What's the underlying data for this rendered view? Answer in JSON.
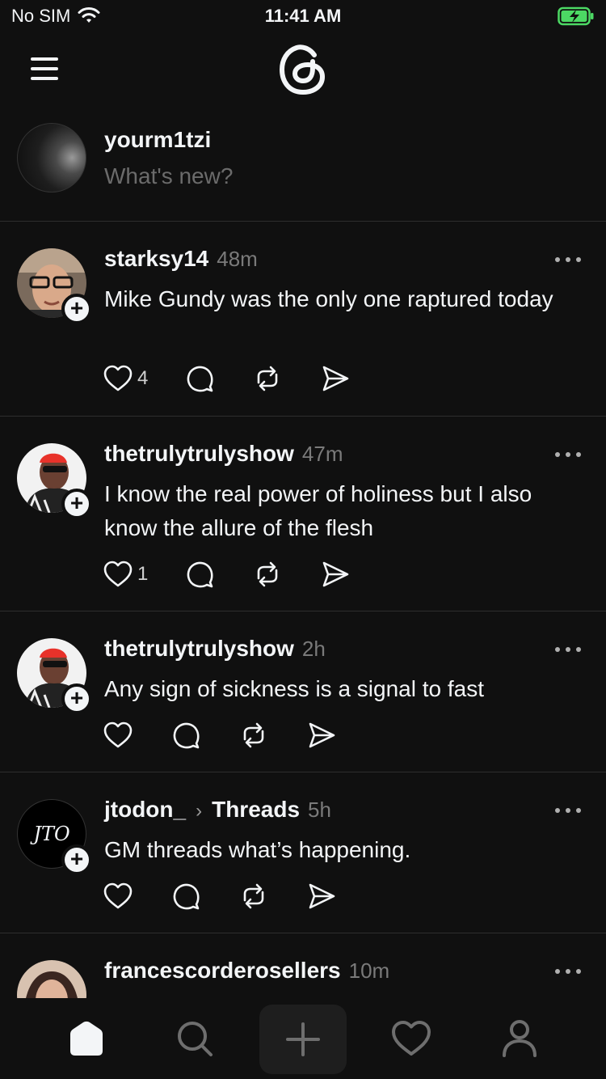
{
  "status": {
    "carrier": "No SIM",
    "time": "11:41 AM"
  },
  "composer": {
    "username": "yourm1tzi",
    "placeholder": "What's new?"
  },
  "posts": [
    {
      "username": "starksy14",
      "time": "48m",
      "text": "Mike Gundy was the only one raptured today",
      "likes": "4"
    },
    {
      "username": "thetrulytrulyshow",
      "time": "47m",
      "text": "I know the real power of holiness but I also know the allure of the flesh",
      "likes": "1"
    },
    {
      "username": "thetrulytrulyshow",
      "time": "2h",
      "text": "Any sign of sickness is a signal to fast",
      "likes": ""
    },
    {
      "username": "jtodon_",
      "community": "Threads",
      "time": "5h",
      "text": "GM threads what’s happening.",
      "likes": "",
      "avatar_text": "JTO"
    },
    {
      "username": "francescorderosellers",
      "time": "10m",
      "text": "",
      "likes": ""
    }
  ],
  "icons": {
    "menu": "menu-icon",
    "logo": "threads-logo-icon",
    "like": "heart-icon",
    "reply": "comment-icon",
    "repost": "repost-icon",
    "share": "send-icon",
    "more": "more-icon",
    "follow": "plus-icon"
  },
  "tabs": [
    "home-icon",
    "search-icon",
    "new-thread-icon",
    "activity-icon",
    "profile-icon"
  ],
  "colors": {
    "background": "#101010",
    "text": "#f3f5f7",
    "muted": "#7a7a7a",
    "battery": "#4cd964"
  }
}
